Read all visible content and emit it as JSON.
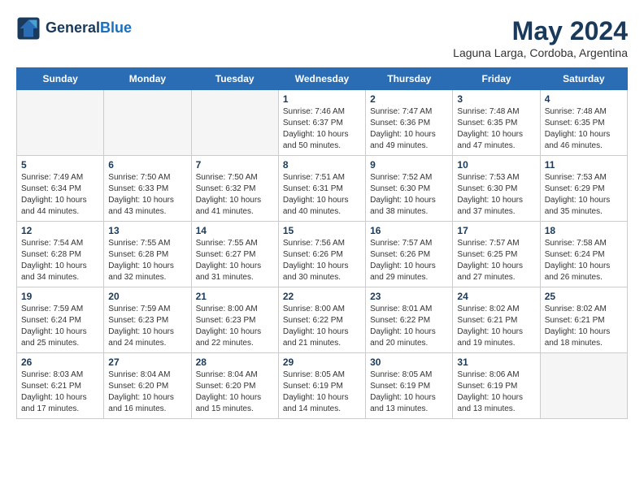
{
  "header": {
    "logo_line1": "General",
    "logo_line2": "Blue",
    "month_year": "May 2024",
    "location": "Laguna Larga, Cordoba, Argentina"
  },
  "days_of_week": [
    "Sunday",
    "Monday",
    "Tuesday",
    "Wednesday",
    "Thursday",
    "Friday",
    "Saturday"
  ],
  "weeks": [
    [
      {
        "day": "",
        "empty": true
      },
      {
        "day": "",
        "empty": true
      },
      {
        "day": "",
        "empty": true
      },
      {
        "day": "1",
        "sunrise": "7:46 AM",
        "sunset": "6:37 PM",
        "daylight": "10 hours and 50 minutes."
      },
      {
        "day": "2",
        "sunrise": "7:47 AM",
        "sunset": "6:36 PM",
        "daylight": "10 hours and 49 minutes."
      },
      {
        "day": "3",
        "sunrise": "7:48 AM",
        "sunset": "6:35 PM",
        "daylight": "10 hours and 47 minutes."
      },
      {
        "day": "4",
        "sunrise": "7:48 AM",
        "sunset": "6:35 PM",
        "daylight": "10 hours and 46 minutes."
      }
    ],
    [
      {
        "day": "5",
        "sunrise": "7:49 AM",
        "sunset": "6:34 PM",
        "daylight": "10 hours and 44 minutes."
      },
      {
        "day": "6",
        "sunrise": "7:50 AM",
        "sunset": "6:33 PM",
        "daylight": "10 hours and 43 minutes."
      },
      {
        "day": "7",
        "sunrise": "7:50 AM",
        "sunset": "6:32 PM",
        "daylight": "10 hours and 41 minutes."
      },
      {
        "day": "8",
        "sunrise": "7:51 AM",
        "sunset": "6:31 PM",
        "daylight": "10 hours and 40 minutes."
      },
      {
        "day": "9",
        "sunrise": "7:52 AM",
        "sunset": "6:30 PM",
        "daylight": "10 hours and 38 minutes."
      },
      {
        "day": "10",
        "sunrise": "7:53 AM",
        "sunset": "6:30 PM",
        "daylight": "10 hours and 37 minutes."
      },
      {
        "day": "11",
        "sunrise": "7:53 AM",
        "sunset": "6:29 PM",
        "daylight": "10 hours and 35 minutes."
      }
    ],
    [
      {
        "day": "12",
        "sunrise": "7:54 AM",
        "sunset": "6:28 PM",
        "daylight": "10 hours and 34 minutes."
      },
      {
        "day": "13",
        "sunrise": "7:55 AM",
        "sunset": "6:28 PM",
        "daylight": "10 hours and 32 minutes."
      },
      {
        "day": "14",
        "sunrise": "7:55 AM",
        "sunset": "6:27 PM",
        "daylight": "10 hours and 31 minutes."
      },
      {
        "day": "15",
        "sunrise": "7:56 AM",
        "sunset": "6:26 PM",
        "daylight": "10 hours and 30 minutes."
      },
      {
        "day": "16",
        "sunrise": "7:57 AM",
        "sunset": "6:26 PM",
        "daylight": "10 hours and 29 minutes."
      },
      {
        "day": "17",
        "sunrise": "7:57 AM",
        "sunset": "6:25 PM",
        "daylight": "10 hours and 27 minutes."
      },
      {
        "day": "18",
        "sunrise": "7:58 AM",
        "sunset": "6:24 PM",
        "daylight": "10 hours and 26 minutes."
      }
    ],
    [
      {
        "day": "19",
        "sunrise": "7:59 AM",
        "sunset": "6:24 PM",
        "daylight": "10 hours and 25 minutes."
      },
      {
        "day": "20",
        "sunrise": "7:59 AM",
        "sunset": "6:23 PM",
        "daylight": "10 hours and 24 minutes."
      },
      {
        "day": "21",
        "sunrise": "8:00 AM",
        "sunset": "6:23 PM",
        "daylight": "10 hours and 22 minutes."
      },
      {
        "day": "22",
        "sunrise": "8:00 AM",
        "sunset": "6:22 PM",
        "daylight": "10 hours and 21 minutes."
      },
      {
        "day": "23",
        "sunrise": "8:01 AM",
        "sunset": "6:22 PM",
        "daylight": "10 hours and 20 minutes."
      },
      {
        "day": "24",
        "sunrise": "8:02 AM",
        "sunset": "6:21 PM",
        "daylight": "10 hours and 19 minutes."
      },
      {
        "day": "25",
        "sunrise": "8:02 AM",
        "sunset": "6:21 PM",
        "daylight": "10 hours and 18 minutes."
      }
    ],
    [
      {
        "day": "26",
        "sunrise": "8:03 AM",
        "sunset": "6:21 PM",
        "daylight": "10 hours and 17 minutes."
      },
      {
        "day": "27",
        "sunrise": "8:04 AM",
        "sunset": "6:20 PM",
        "daylight": "10 hours and 16 minutes."
      },
      {
        "day": "28",
        "sunrise": "8:04 AM",
        "sunset": "6:20 PM",
        "daylight": "10 hours and 15 minutes."
      },
      {
        "day": "29",
        "sunrise": "8:05 AM",
        "sunset": "6:19 PM",
        "daylight": "10 hours and 14 minutes."
      },
      {
        "day": "30",
        "sunrise": "8:05 AM",
        "sunset": "6:19 PM",
        "daylight": "10 hours and 13 minutes."
      },
      {
        "day": "31",
        "sunrise": "8:06 AM",
        "sunset": "6:19 PM",
        "daylight": "10 hours and 13 minutes."
      },
      {
        "day": "",
        "empty": true
      }
    ]
  ]
}
